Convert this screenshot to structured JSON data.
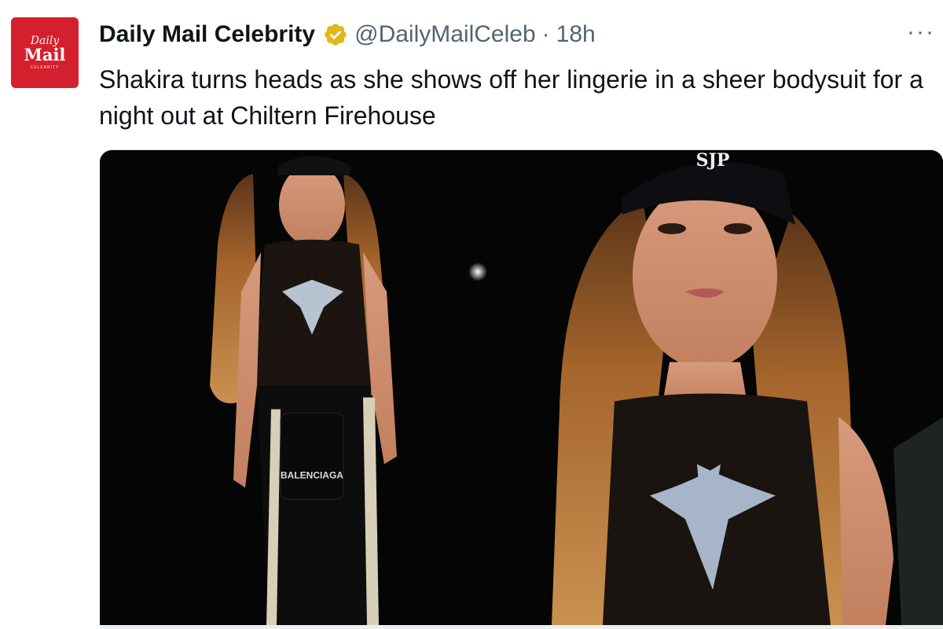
{
  "account": {
    "avatar": {
      "line1": "Daily",
      "line2": "Mail",
      "line3": "CELEBRITY",
      "bg": "#d4202e"
    },
    "name": "Daily Mail Celebrity",
    "handle": "@DailyMailCeleb",
    "separator": "·",
    "time": "18h",
    "verified_badge_color": "#e2b719"
  },
  "more_menu_glyph": "···",
  "tweet_text": "Shakira turns heads as she shows off her lingerie in a sheer bodysuit for a night out at Chiltern Firehouse",
  "media": {
    "description_icon": "photo",
    "bag_text": "BALENCIAGA",
    "cap_text": "SJP"
  }
}
